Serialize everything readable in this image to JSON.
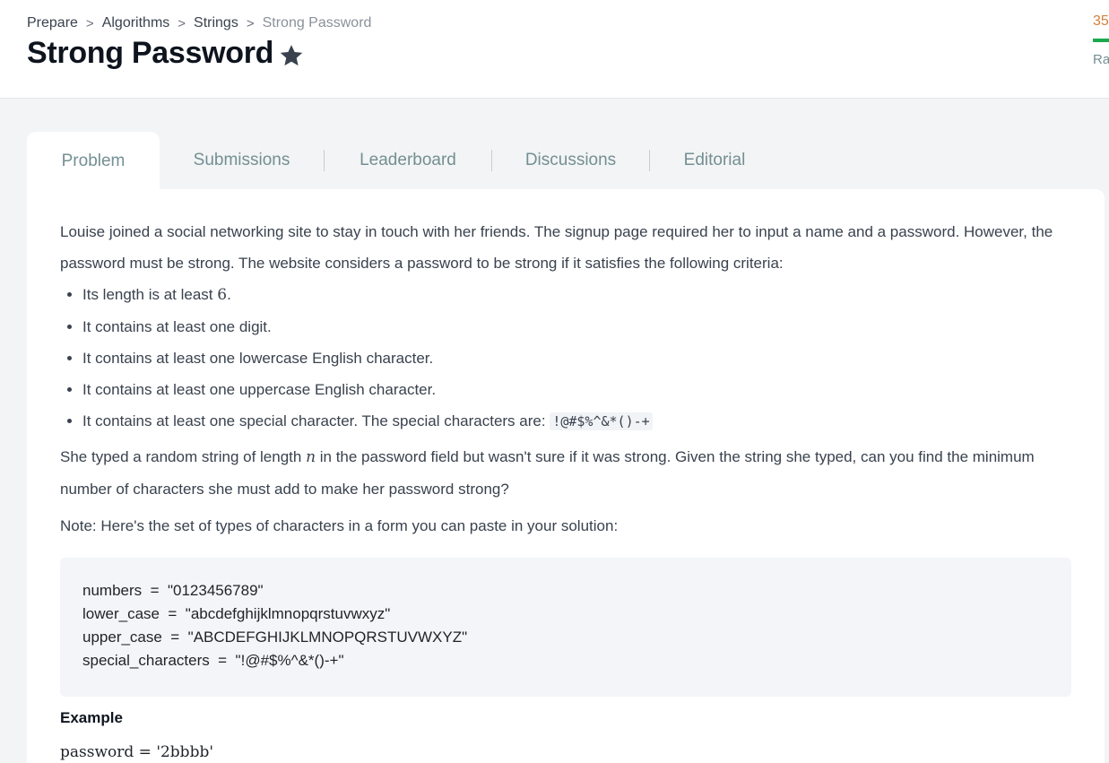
{
  "breadcrumb": {
    "items": [
      "Prepare",
      "Algorithms",
      "Strings"
    ],
    "separator": ">",
    "current": "Strong Password"
  },
  "page_title": "Strong Password",
  "score": {
    "value": "35",
    "label": "Ra"
  },
  "tabs": [
    {
      "label": "Problem",
      "active": true
    },
    {
      "label": "Submissions",
      "active": false
    },
    {
      "label": "Leaderboard",
      "active": false
    },
    {
      "label": "Discussions",
      "active": false
    },
    {
      "label": "Editorial",
      "active": false
    }
  ],
  "problem": {
    "intro": "Louise joined a social networking site to stay in touch with her friends. The signup page required her to input a name and a password. However, the password must be strong. The website considers a password to be strong if it satisfies the following criteria:",
    "criteria": {
      "c1_prefix": "Its length is at least ",
      "c1_value": "6",
      "c1_suffix": ".",
      "c2": "It contains at least one digit.",
      "c3": "It contains at least one lowercase English character.",
      "c4": "It contains at least one uppercase English character.",
      "c5_prefix": "It contains at least one special character. The special characters are: ",
      "c5_code": "!@#$%^&*()-+"
    },
    "para2_prefix": "She typed a random string of length ",
    "para2_var": "n",
    "para2_suffix": " in the password field but wasn't sure if it was strong. Given the string she typed, can you find the minimum number of characters she must add to make her password strong?",
    "note": "Note: Here's the set of types of characters in a form you can paste in your solution:",
    "code_lines": [
      "numbers  =  \"0123456789\"",
      "lower_case  =  \"abcdefghijklmnopqrstuvwxyz\"",
      "upper_case  =  \"ABCDEFGHIJKLMNOPQRSTUVWXYZ\"",
      "special_characters  =  \"!@#$%^&*()-+\""
    ],
    "example_heading": "Example",
    "example_line": "password = '2bbbb'"
  },
  "colors": {
    "score": "#d4813a",
    "score_bar": "#1ba94c",
    "tab_text": "#738f93",
    "background": "#f3f4f5"
  },
  "icons": {
    "favorite": "star-icon"
  }
}
